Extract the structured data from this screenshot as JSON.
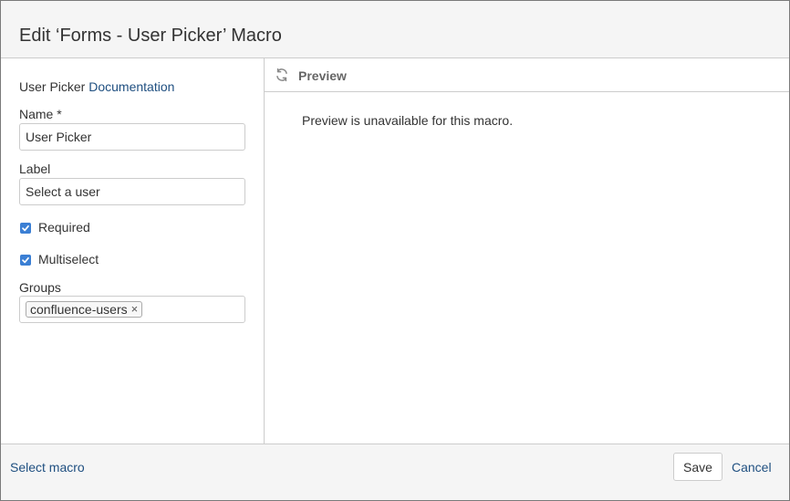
{
  "dialog": {
    "title": "Edit ‘Forms - User Picker’ Macro"
  },
  "form": {
    "doc_prefix": "User Picker ",
    "doc_link": "Documentation",
    "name_label": "Name *",
    "name_value": "User Picker",
    "label_label": "Label",
    "label_value": "Select a user",
    "required_label": "Required",
    "required_checked": true,
    "multiselect_label": "Multiselect",
    "multiselect_checked": true,
    "groups_label": "Groups",
    "groups": [
      "confluence-users"
    ],
    "tag_remove": "×"
  },
  "preview": {
    "title": "Preview",
    "message": "Preview is unavailable for this macro.",
    "icon": "refresh-icon"
  },
  "footer": {
    "select_macro": "Select macro",
    "save": "Save",
    "cancel": "Cancel"
  },
  "colors": {
    "link": "#205081",
    "checkbox": "#3b7fd4",
    "header_bg": "#f5f5f5"
  }
}
